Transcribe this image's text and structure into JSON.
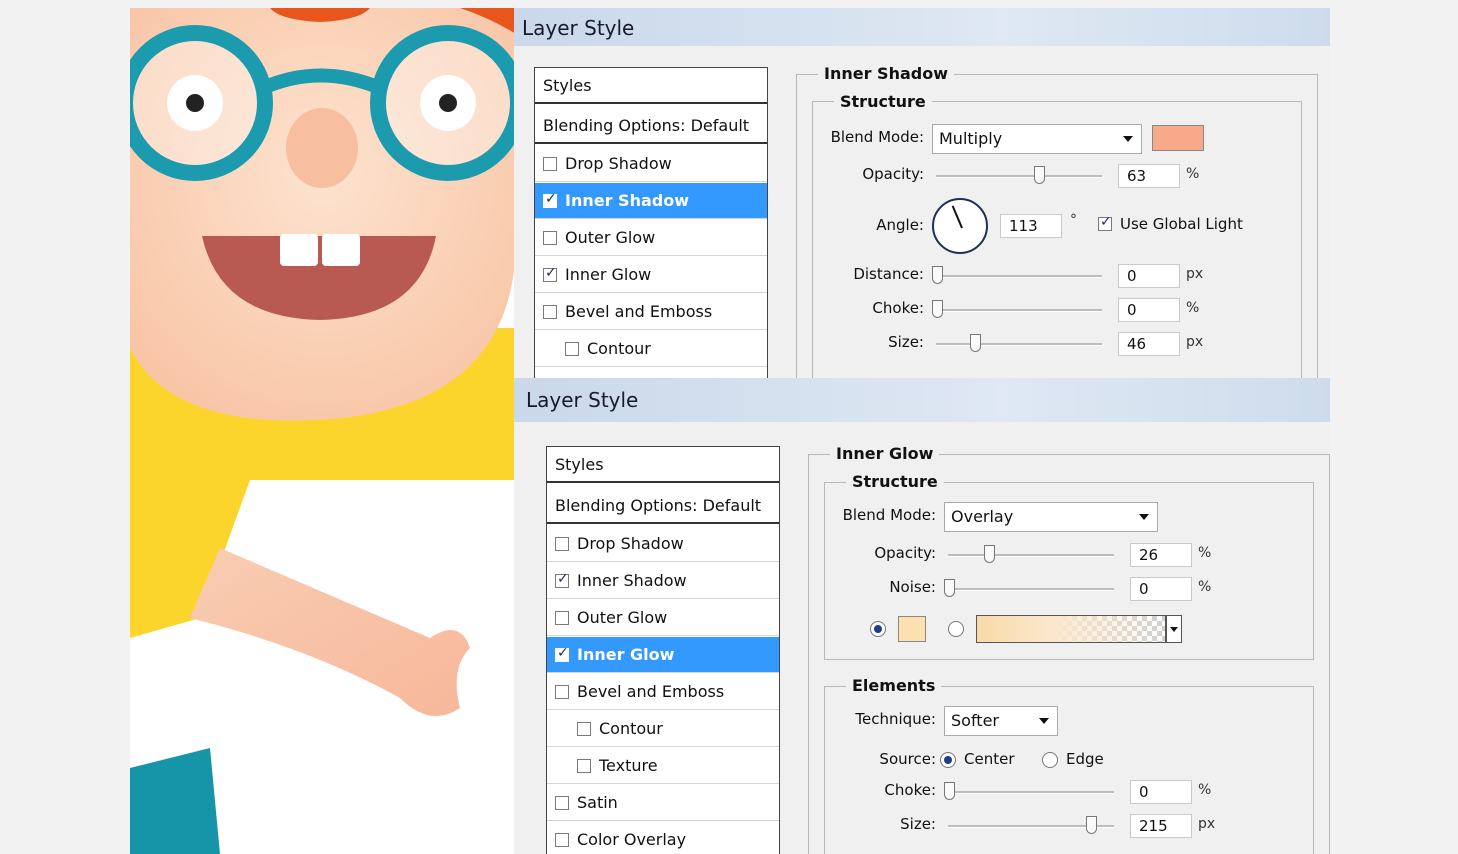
{
  "dialog1": {
    "title": "Layer Style",
    "sidebar": [
      {
        "label": "Styles",
        "type": "header"
      },
      {
        "label": "Blending Options: Default",
        "type": "header"
      },
      {
        "label": "Drop Shadow",
        "checked": false
      },
      {
        "label": "Inner Shadow",
        "checked": true,
        "selected": true
      },
      {
        "label": "Outer Glow",
        "checked": false
      },
      {
        "label": "Inner Glow",
        "checked": true
      },
      {
        "label": "Bevel and Emboss",
        "checked": false
      },
      {
        "label": "Contour",
        "checked": false,
        "indent": true
      }
    ],
    "section_title": "Inner Shadow",
    "structure_title": "Structure",
    "blend_mode_label": "Blend Mode:",
    "blend_mode": "Multiply",
    "shadow_color": "#f7a98a",
    "opacity_label": "Opacity:",
    "opacity": "63",
    "angle_label": "Angle:",
    "angle": "113",
    "degree_symbol": "°",
    "use_global_light_label": "Use Global Light",
    "use_global_light": true,
    "distance_label": "Distance:",
    "distance": "0",
    "choke_label": "Choke:",
    "choke": "0",
    "size_label": "Size:",
    "size": "46",
    "unit_percent": "%",
    "unit_px": "px"
  },
  "dialog2": {
    "title": "Layer Style",
    "sidebar": [
      {
        "label": "Styles",
        "type": "header"
      },
      {
        "label": "Blending Options: Default",
        "type": "header"
      },
      {
        "label": "Drop Shadow",
        "checked": false
      },
      {
        "label": "Inner Shadow",
        "checked": true
      },
      {
        "label": "Outer Glow",
        "checked": false
      },
      {
        "label": "Inner Glow",
        "checked": true,
        "selected": true
      },
      {
        "label": "Bevel and Emboss",
        "checked": false
      },
      {
        "label": "Contour",
        "checked": false,
        "indent": true
      },
      {
        "label": "Texture",
        "checked": false,
        "indent": true
      },
      {
        "label": "Satin",
        "checked": false
      },
      {
        "label": "Color Overlay",
        "checked": false
      }
    ],
    "section_title": "Inner Glow",
    "structure_title": "Structure",
    "blend_mode_label": "Blend Mode:",
    "blend_mode": "Overlay",
    "opacity_label": "Opacity:",
    "opacity": "26",
    "noise_label": "Noise:",
    "noise": "0",
    "glow_color": "#fde0b0",
    "elements_title": "Elements",
    "technique_label": "Technique:",
    "technique": "Softer",
    "source_label": "Source:",
    "source_center_label": "Center",
    "source_edge_label": "Edge",
    "choke_label": "Choke:",
    "choke": "0",
    "size_label": "Size:",
    "size": "215",
    "unit_percent": "%",
    "unit_px": "px"
  },
  "colors": {
    "selection_blue": "#3399ff",
    "glasses_teal": "#1c9aae",
    "shirt_yellow": "#fbd52c",
    "skin": "#fbd0b4",
    "mouth": "#b85a52",
    "hair": "#e8561e"
  }
}
